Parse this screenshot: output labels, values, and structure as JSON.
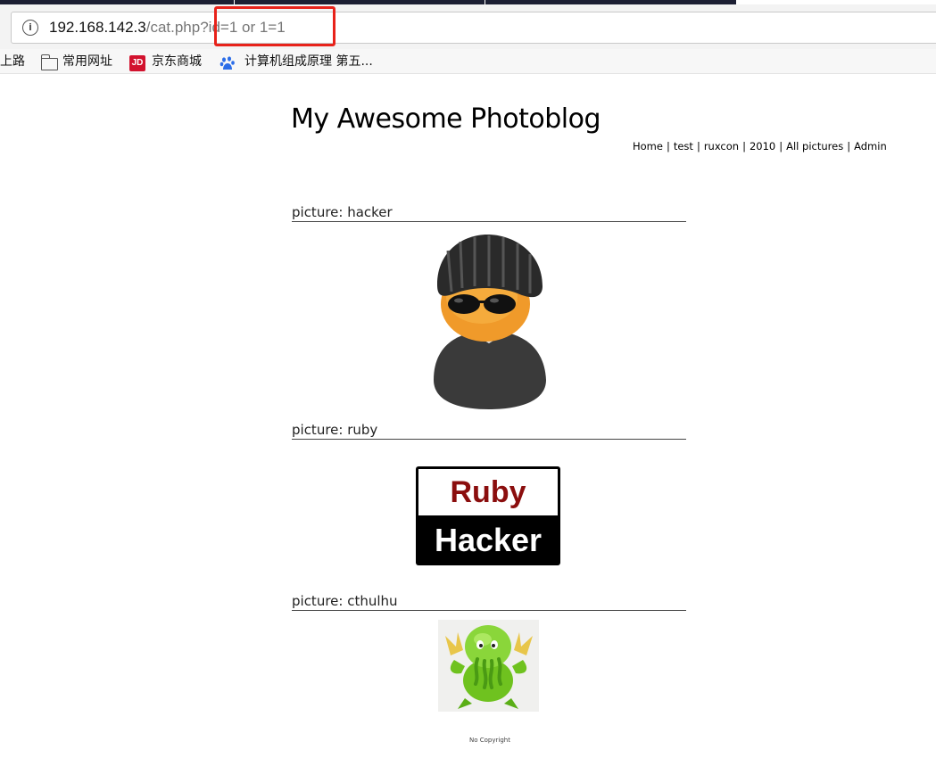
{
  "browser": {
    "url_host": "192.168.142.3",
    "url_path": "/cat.php?id=1 or 1=1",
    "bookmarks": [
      {
        "label": "上路",
        "icon": "none"
      },
      {
        "label": "常用网址",
        "icon": "folder-icon"
      },
      {
        "label": "京东商城",
        "icon": "jd-icon"
      },
      {
        "label": "计算机组成原理 第五...",
        "icon": "baidu-paw-icon"
      }
    ],
    "jd_icon_text": "JD"
  },
  "site": {
    "title": "My Awesome Photoblog",
    "nav": [
      "Home",
      "test",
      "ruxcon",
      "2010",
      "All pictures",
      "Admin"
    ],
    "nav_separator": "|"
  },
  "posts": [
    {
      "heading": "picture: hacker",
      "image": "hacker-avatar-image"
    },
    {
      "heading": "picture: ruby",
      "image": "ruby-hacker-logo-image",
      "logo_text_top": "Ruby",
      "logo_text_bottom": "Hacker"
    },
    {
      "heading": "picture: cthulhu",
      "image": "cthulhu-image"
    }
  ],
  "footer": {
    "text": "No Copyright"
  },
  "colors": {
    "highlight_border": "#e8221a",
    "jd_red": "#d2122e",
    "ruby_red": "#8b0e0e",
    "cthulhu_green": "#7dcc2a"
  }
}
